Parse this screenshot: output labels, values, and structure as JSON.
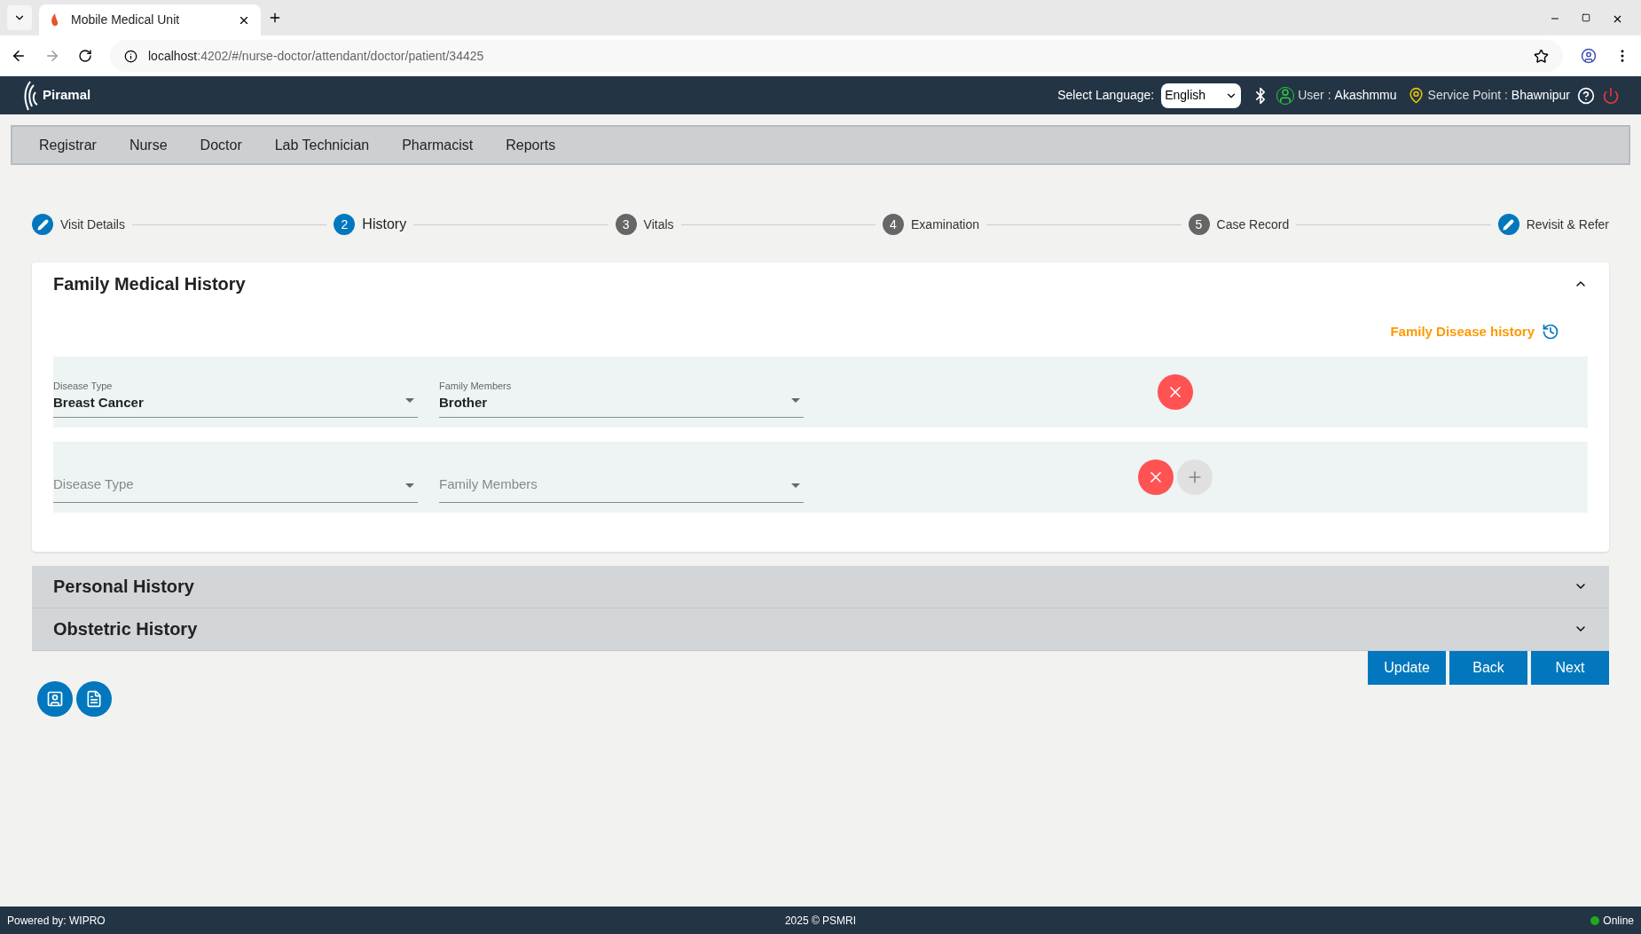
{
  "browser": {
    "tab_title": "Mobile Medical Unit",
    "url_host": "localhost",
    "url_path": ":4202/#/nurse-doctor/attendant/doctor/patient/34425"
  },
  "header": {
    "brand": "Piramal",
    "language_label": "Select Language:",
    "language": "English",
    "user_label": "User :",
    "user": "Akashmmu",
    "service_point_label": "Service Point :",
    "service_point": "Bhawnipur"
  },
  "nav": [
    "Registrar",
    "Nurse",
    "Doctor",
    "Lab Technician",
    "Pharmacist",
    "Reports"
  ],
  "steps": [
    {
      "kind": "edit",
      "label": "Visit Details",
      "selected": false
    },
    {
      "kind": "number",
      "number": "2",
      "label": "History",
      "selected": true
    },
    {
      "kind": "number",
      "number": "3",
      "label": "Vitals",
      "selected": false
    },
    {
      "kind": "number",
      "number": "4",
      "label": "Examination",
      "selected": false
    },
    {
      "kind": "number",
      "number": "5",
      "label": "Case Record",
      "selected": false
    },
    {
      "kind": "edit",
      "label": "Revisit & Refer",
      "selected": false
    }
  ],
  "sections": [
    {
      "title": "Family Medical History",
      "expanded": true,
      "history_link": "Family Disease history",
      "rows": [
        {
          "disease": {
            "label": "Disease Type",
            "value": "Breast Cancer"
          },
          "members": {
            "label": "Family Members",
            "value": "Brother"
          },
          "can_add": false
        },
        {
          "disease": {
            "placeholder": "Disease Type"
          },
          "members": {
            "placeholder": "Family Members"
          },
          "can_add": true
        }
      ]
    },
    {
      "title": "Personal History",
      "expanded": false
    },
    {
      "title": "Obstetric History",
      "expanded": false
    }
  ],
  "buttons": [
    "Update",
    "Back",
    "Next"
  ],
  "footer": {
    "left": "Powered by: WIPRO",
    "center": "2025 © PSMRI",
    "status": "Online"
  }
}
